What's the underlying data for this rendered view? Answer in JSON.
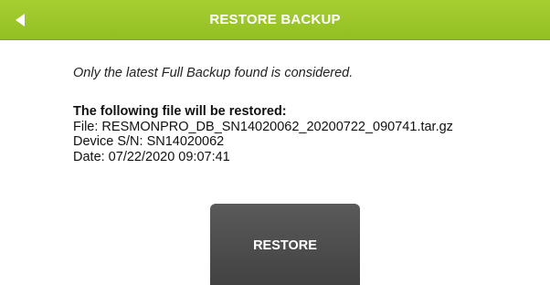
{
  "header": {
    "title": "RESTORE BACKUP",
    "back_icon": "back-arrow-icon",
    "color": "#9bc52a"
  },
  "content": {
    "note": "Only the latest Full Backup found is considered.",
    "heading": "The following file will be restored:",
    "file_line": "File: RESMONPRO_DB_SN14020062_20200722_090741.tar.gz",
    "device_line": "Device S/N: SN14020062",
    "date_line": "Date: 07/22/2020 09:07:41"
  },
  "actions": {
    "restore_label": "RESTORE"
  }
}
